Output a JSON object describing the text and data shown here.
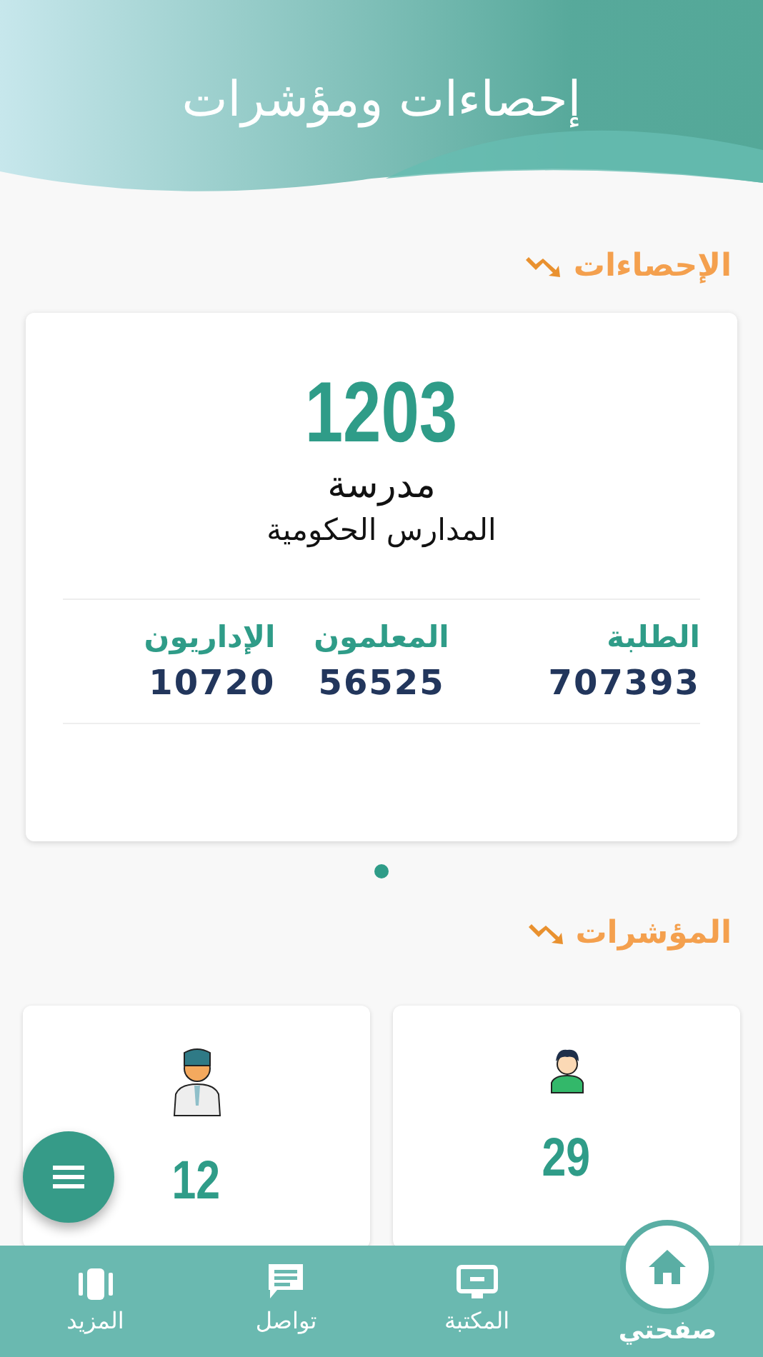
{
  "header": {
    "title": "إحصاءات ومؤشرات"
  },
  "statistics": {
    "heading": "الإحصاءات",
    "card": {
      "value": "1203",
      "unit": "مدرسة",
      "subtitle": "المدارس الحكومية",
      "metrics": [
        {
          "label": "الطلبة",
          "value": "707393"
        },
        {
          "label": "المعلمون",
          "value": "56525"
        },
        {
          "label": "الإداريون",
          "value": "10720"
        }
      ]
    },
    "pages": [
      {
        "selected": true
      }
    ]
  },
  "indicators": {
    "heading": "المؤشرات",
    "cards": [
      {
        "kind": "student",
        "value": "29"
      },
      {
        "kind": "man",
        "value": "12"
      }
    ]
  },
  "bottom_nav": [
    {
      "kind": "home",
      "label": "صفحتي",
      "selected": true
    },
    {
      "kind": "library",
      "label": "المكتبة",
      "selected": false
    },
    {
      "kind": "chat",
      "label": "تواصل",
      "selected": false
    },
    {
      "kind": "more",
      "label": "المزيد",
      "selected": false
    }
  ]
}
